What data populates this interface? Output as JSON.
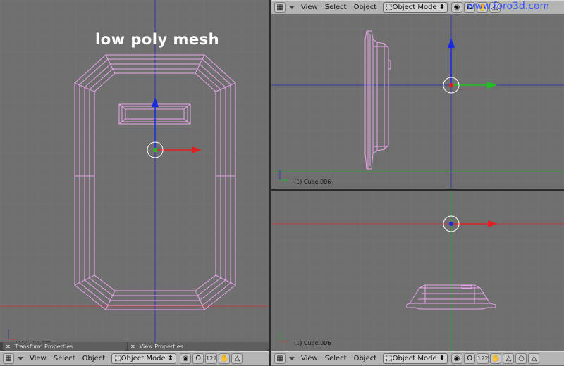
{
  "overlay": {
    "title": "low poly mesh"
  },
  "watermark": "www.foro3d.com",
  "object_label": "(1) Cube.006",
  "object_label_partial": "(1) Cube.006",
  "menus": {
    "view": "View",
    "select": "Select",
    "object": "Object"
  },
  "mode": {
    "selected": "Object Mode"
  },
  "layer_value": "122",
  "panels": [
    {
      "label": "Transform Properties"
    },
    {
      "label": "View Properties"
    }
  ],
  "colors": {
    "viewport_bg": "#6f6f6f",
    "grid": "#777777",
    "mesh_wire": "#e9a4ec",
    "axis_red": "#c84040",
    "axis_blue": "#3a3aa8",
    "arrow_red": "#e02020",
    "arrow_green": "#20c020",
    "arrow_blue": "#1a2ae0",
    "header_bg": "#b4b4b4",
    "watermark": "#3850ff"
  },
  "icons": [
    "grid-icon",
    "chevron-down-icon",
    "object-mode-icon",
    "pivot-icon",
    "manipulator-icon",
    "hand-icon",
    "triangle-icon",
    "circle-icon"
  ]
}
